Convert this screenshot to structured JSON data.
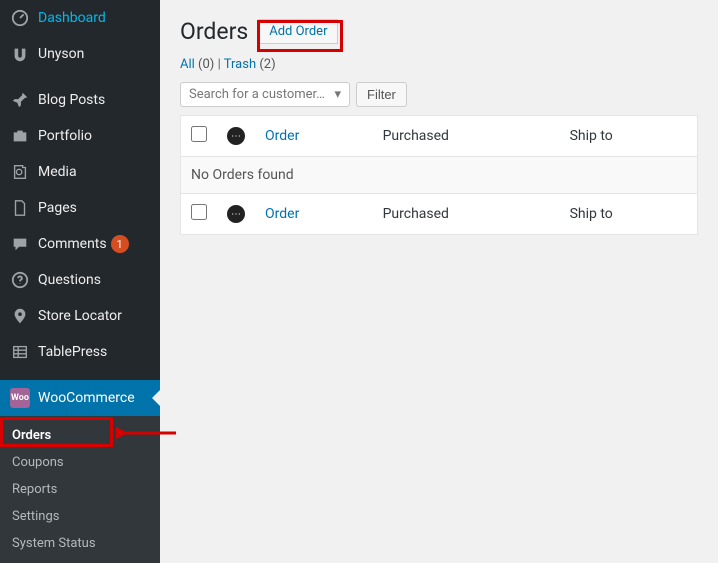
{
  "sidebar": {
    "items": [
      {
        "label": "Dashboard"
      },
      {
        "label": "Unyson"
      },
      {
        "label": "Blog Posts"
      },
      {
        "label": "Portfolio"
      },
      {
        "label": "Media"
      },
      {
        "label": "Pages"
      },
      {
        "label": "Comments",
        "badge": "1"
      },
      {
        "label": "Questions"
      },
      {
        "label": "Store Locator"
      },
      {
        "label": "TablePress"
      },
      {
        "label": "WooCommerce"
      }
    ],
    "submenu": [
      {
        "label": "Orders"
      },
      {
        "label": "Coupons"
      },
      {
        "label": "Reports"
      },
      {
        "label": "Settings"
      },
      {
        "label": "System Status"
      }
    ]
  },
  "page": {
    "title": "Orders",
    "add_button": "Add Order"
  },
  "filters": {
    "all_label": "All",
    "all_count": "(0)",
    "sep": " | ",
    "trash_label": "Trash",
    "trash_count": "(2)"
  },
  "tablenav": {
    "search_placeholder": "Search for a customer…",
    "filter_label": "Filter"
  },
  "table": {
    "col_order": "Order",
    "col_purchased": "Purchased",
    "col_shipto": "Ship to",
    "no_items": "No Orders found"
  }
}
